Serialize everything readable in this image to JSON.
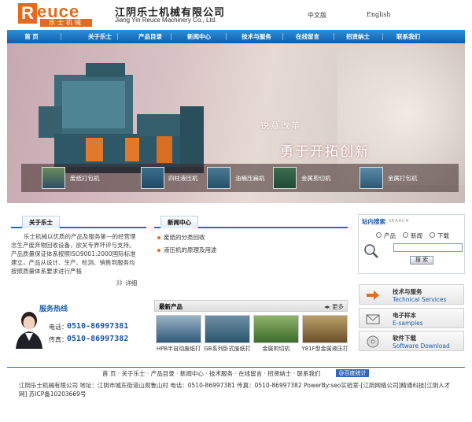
{
  "header": {
    "logo_r": "R",
    "logo_rest": "euce",
    "logo_sub": "乐士机械",
    "company_cn": "江阴乐士机械有限公司",
    "company_en": "Jiang Yin Reuce Machinery Co., Ltd.",
    "lang_cn": "中文版",
    "lang_en": "English"
  },
  "nav": [
    "首 页",
    "关于乐士",
    "产品目录",
    "新闻中心",
    "技术与服务",
    "在线留言",
    "招贤纳士",
    "联系我们"
  ],
  "banner": {
    "slogan1": "锐意改革",
    "slogan2": "勇于开拓创新",
    "products": [
      "废纸打包机",
      "四柱液压机",
      "油桶压扁机",
      "金属剪切机",
      "金属打包机"
    ]
  },
  "about": {
    "title": "关于乐士",
    "text": "乐士机械以优质的产品及服务第一的经营理念生产废弃物回收设备，欲关专界坏评与支持。产品质量保证体系按照ISO9001:2000国际标准建立，产品从设计、生产、检测、销售到服务均按照质量体系要求进行严格",
    "more": "》》详细"
  },
  "service": {
    "title": "服务热线",
    "phone_label": "电话：",
    "phone": "0510-86997381",
    "fax_label": "传真：",
    "fax": "0510-86997382"
  },
  "news": {
    "title": "新闻中心",
    "items": [
      "废纸的分类回收",
      "液压机的原理及用途"
    ]
  },
  "new_products": {
    "title": "最新产品",
    "more": "更多",
    "items": [
      "HPB半自动废纸打",
      "GB系列卧式废纸打",
      "金属剪切机",
      "Y81F型金属液压打"
    ]
  },
  "search": {
    "title": "站内搜索",
    "subtitle": "SEARCH",
    "options": [
      "产品",
      "新闻",
      "下载"
    ],
    "button": "搜 索"
  },
  "side_links": [
    {
      "cn": "技术与服务",
      "en": "Technical Services"
    },
    {
      "cn": "电子样本",
      "en": "E-samples"
    },
    {
      "cn": "软件下载",
      "en": "Software Download"
    }
  ],
  "footer": {
    "nav": "首 页 · 关于乐士 · 产品目录 · 新闻中心 · 技术服务 · 在线留言 · 招贤纳士 · 联系我们",
    "badge": "@百度统计",
    "info": "江阴乐士机械有限公司 地址：江阴市城东街道山观鲁山村 电话：0510-86997381 传真：0510-86997382 PowerBy:seo实验室-[江阴网络公司]精通科技[江阴人才网] 苏ICP备10203669号"
  },
  "colors": {
    "brand_orange": "#e56a1c",
    "nav_blue": "#1c6fc2"
  }
}
